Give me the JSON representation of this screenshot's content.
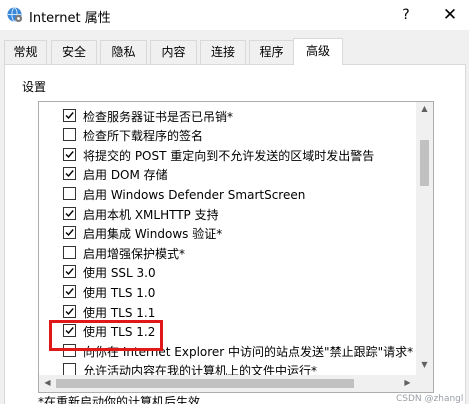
{
  "window": {
    "title": "Internet 属性",
    "help": "?",
    "close": "✕"
  },
  "tabs": [
    {
      "label": "常规"
    },
    {
      "label": "安全"
    },
    {
      "label": "隐私"
    },
    {
      "label": "内容"
    },
    {
      "label": "连接"
    },
    {
      "label": "程序"
    },
    {
      "label": "高级",
      "selected": true
    }
  ],
  "settings": {
    "section_label": "设置",
    "items": [
      {
        "label": "检查服务器证书是否已吊销*",
        "checked": true
      },
      {
        "label": "检查所下载程序的签名",
        "checked": false
      },
      {
        "label": "将提交的 POST 重定向到不允许发送的区域时发出警告",
        "checked": true
      },
      {
        "label": "启用 DOM 存储",
        "checked": true
      },
      {
        "label": "启用 Windows Defender SmartScreen",
        "checked": false
      },
      {
        "label": "启用本机 XMLHTTP 支持",
        "checked": true
      },
      {
        "label": "启用集成 Windows 验证*",
        "checked": true
      },
      {
        "label": "启用增强保护模式*",
        "checked": false
      },
      {
        "label": "使用 SSL 3.0",
        "checked": true
      },
      {
        "label": "使用 TLS 1.0",
        "checked": true
      },
      {
        "label": "使用 TLS 1.1",
        "checked": true
      },
      {
        "label": "使用 TLS 1.2",
        "checked": true,
        "highlighted": true
      },
      {
        "label": "向你在 Internet Explorer 中访问的站点发送\"禁止跟踪\"请求*",
        "checked": false
      },
      {
        "label": "允许活动内容在我的计算机上的文件中运行*",
        "checked": false
      }
    ]
  },
  "footnote": "*在重新启动你的计算机后生效",
  "watermark": "CSDN @zhangl",
  "colors": {
    "highlight": "#e01818"
  }
}
